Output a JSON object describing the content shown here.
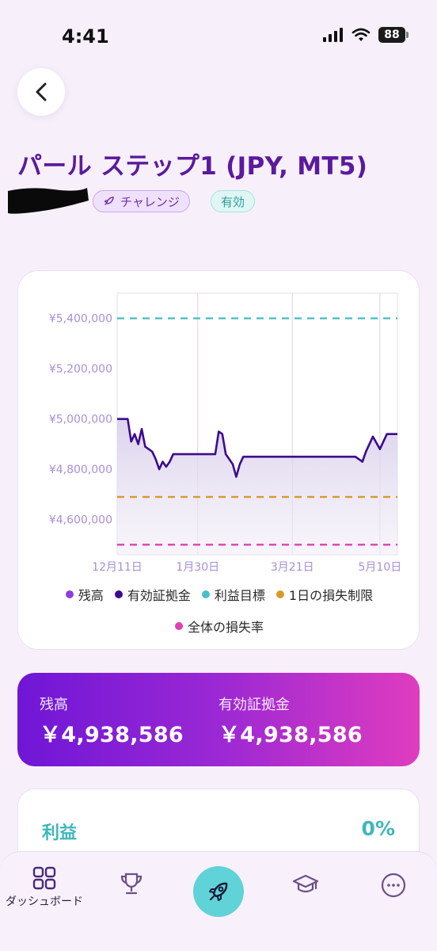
{
  "status_bar": {
    "time": "4:41",
    "battery": "88"
  },
  "header": {
    "title": "パール ステップ1 (JPY, MT5)",
    "badges": {
      "challenge": "チャレンジ",
      "active": "有効"
    }
  },
  "colors": {
    "title": "#5b1a9e",
    "balance_line": "#8b3fe0",
    "equity_line": "#3d0b8f",
    "profit_target": "#4bbfc8",
    "daily_loss": "#d99a2b",
    "overall_loss": "#e040b0",
    "accent_cyan": "#5fd3d8"
  },
  "chart_data": {
    "type": "line",
    "y_ticks": [
      "¥5,400,000",
      "¥5,200,000",
      "¥5,000,000",
      "¥4,800,000",
      "¥4,600,000"
    ],
    "y_tick_values": [
      5400000,
      5200000,
      5000000,
      4800000,
      4600000
    ],
    "x_ticks": [
      "12月11日",
      "1月30日",
      "3月21日",
      "5月10日"
    ],
    "ylim": [
      4460000,
      5500000
    ],
    "legend_position": "bottom",
    "grid": true,
    "lines": {
      "profit_target": 5400000,
      "daily_loss": 4690000,
      "overall_loss": 4500000
    },
    "series": [
      {
        "name": "有効証拠金",
        "points": [
          [
            0,
            5000000
          ],
          [
            3,
            5000000
          ],
          [
            4,
            4910000
          ],
          [
            5,
            4940000
          ],
          [
            6,
            4900000
          ],
          [
            7,
            4960000
          ],
          [
            8,
            4890000
          ],
          [
            9,
            4880000
          ],
          [
            10,
            4870000
          ],
          [
            11,
            4840000
          ],
          [
            12,
            4800000
          ],
          [
            13,
            4830000
          ],
          [
            14,
            4810000
          ],
          [
            15,
            4830000
          ],
          [
            16,
            4860000
          ],
          [
            28,
            4860000
          ],
          [
            29,
            4950000
          ],
          [
            30,
            4940000
          ],
          [
            31,
            4860000
          ],
          [
            32,
            4840000
          ],
          [
            33,
            4820000
          ],
          [
            34,
            4770000
          ],
          [
            35,
            4820000
          ],
          [
            36,
            4850000
          ],
          [
            42,
            4850000
          ],
          [
            68,
            4850000
          ],
          [
            70,
            4830000
          ],
          [
            71,
            4870000
          ],
          [
            73,
            4930000
          ],
          [
            75,
            4880000
          ],
          [
            77,
            4940000
          ],
          [
            80,
            4940000
          ]
        ]
      }
    ],
    "legend": [
      "残高",
      "有効証拠金",
      "利益目標",
      "1日の損失制限",
      "全体の損失率"
    ]
  },
  "balance_card": {
    "balance_label": "残高",
    "balance_value": "￥4,938,586",
    "equity_label": "有効証拠金",
    "equity_value": "￥4,938,586"
  },
  "profit": {
    "label": "利益",
    "value": "0%"
  },
  "nav": {
    "dashboard": "ダッシュボード"
  }
}
